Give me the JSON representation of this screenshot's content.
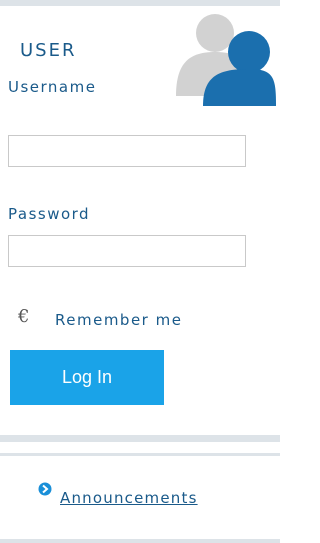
{
  "login": {
    "title": "USER",
    "username_label": "Username",
    "username_value": "",
    "password_label": "Password",
    "password_value": "",
    "remember_label": "Remember me",
    "submit_label": "Log In"
  },
  "links": {
    "announcements_label": "Announcements"
  },
  "icons": {
    "avatar": "user-avatar-icon",
    "remember": "remember-me-icon",
    "announcements": "arrow-circle-icon"
  },
  "colors": {
    "accent": "#1aa3e8",
    "label": "#1a5a8a",
    "band": "#dde3e8"
  }
}
